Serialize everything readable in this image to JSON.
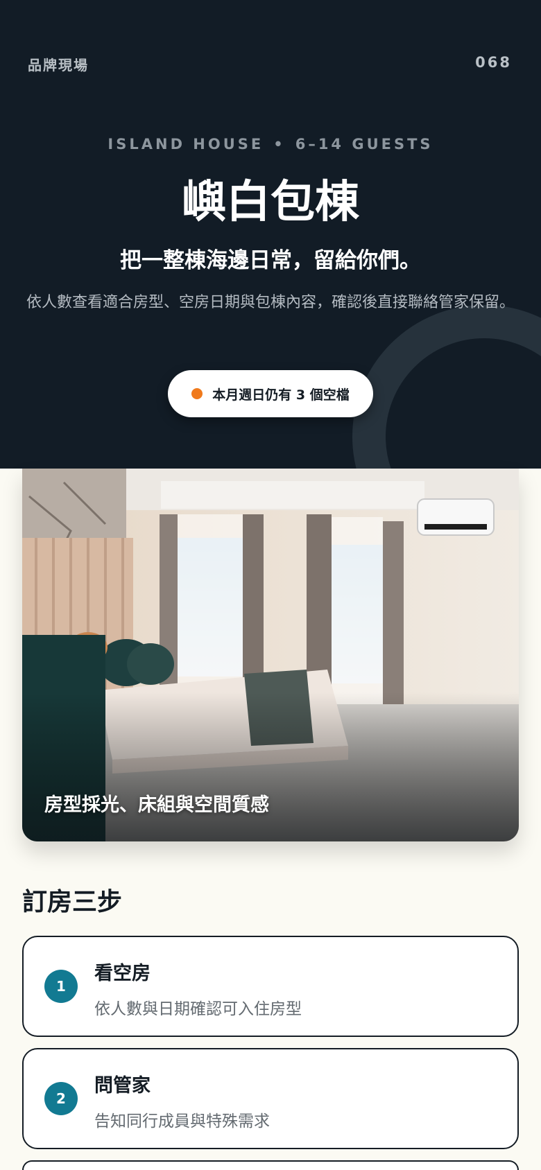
{
  "header": {
    "brand": "品牌現場",
    "counter": "068"
  },
  "hero": {
    "eyebrow_left": "ISLAND HOUSE",
    "eyebrow_dot": "•",
    "eyebrow_right": "6–14 GUESTS",
    "title": "嶼白包棟",
    "subtitle": "把一整棟海邊日常，留給你們。",
    "description": "依人數查看適合房型、空房日期與包棟內容，確認後直接聯絡管家保留。",
    "availability": "本月週日仍有 3 個空檔"
  },
  "photo": {
    "caption": "房型採光、床組與空間質感"
  },
  "steps": {
    "heading": "訂房三步",
    "items": [
      {
        "number": "1",
        "title": "看空房",
        "desc": "依人數與日期確認可入住房型"
      },
      {
        "number": "2",
        "title": "問管家",
        "desc": "告知同行成員與特殊需求"
      }
    ]
  },
  "colors": {
    "hero_bg": "#121c26",
    "page_bg": "#fbfaf3",
    "accent_teal": "#127a92",
    "status_orange": "#f07a1c"
  }
}
